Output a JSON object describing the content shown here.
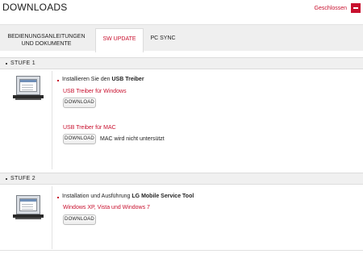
{
  "header": {
    "title": "DOWNLOADS",
    "closed_label": "Geschlossen"
  },
  "tabs": [
    {
      "label_line1": "BEDIENUNGSANLEITUNGEN",
      "label_line2": "UND DOKUMENTE",
      "active": false
    },
    {
      "label_line1": "SW UPDATE",
      "active": true
    },
    {
      "label_line1": "PC SYNC",
      "active": false
    }
  ],
  "stage1": {
    "label": "STUFE 1",
    "instruction_prefix": "Installieren Sie den ",
    "instruction_bold": "USB Treiber",
    "windows_link": "USB Treiber für Windows",
    "windows_button": "DOWNLOAD",
    "mac_link": "USB Treiber für MAC",
    "mac_button": "DOWNLOAD",
    "mac_note": "MAC wird nicht untersützt"
  },
  "stage2": {
    "label": "STUFE 2",
    "instruction_prefix": "Installation und Ausführung ",
    "instruction_bold": "LG Mobile Service Tool",
    "os_link": "Windows XP, Vista und Windows 7",
    "button": "DOWNLOAD"
  },
  "colors": {
    "accent": "#c8102e",
    "tab_bg": "#efefef",
    "stage_bg": "#f0f0f0"
  },
  "icons": [
    "laptop-icon",
    "minus-icon"
  ]
}
